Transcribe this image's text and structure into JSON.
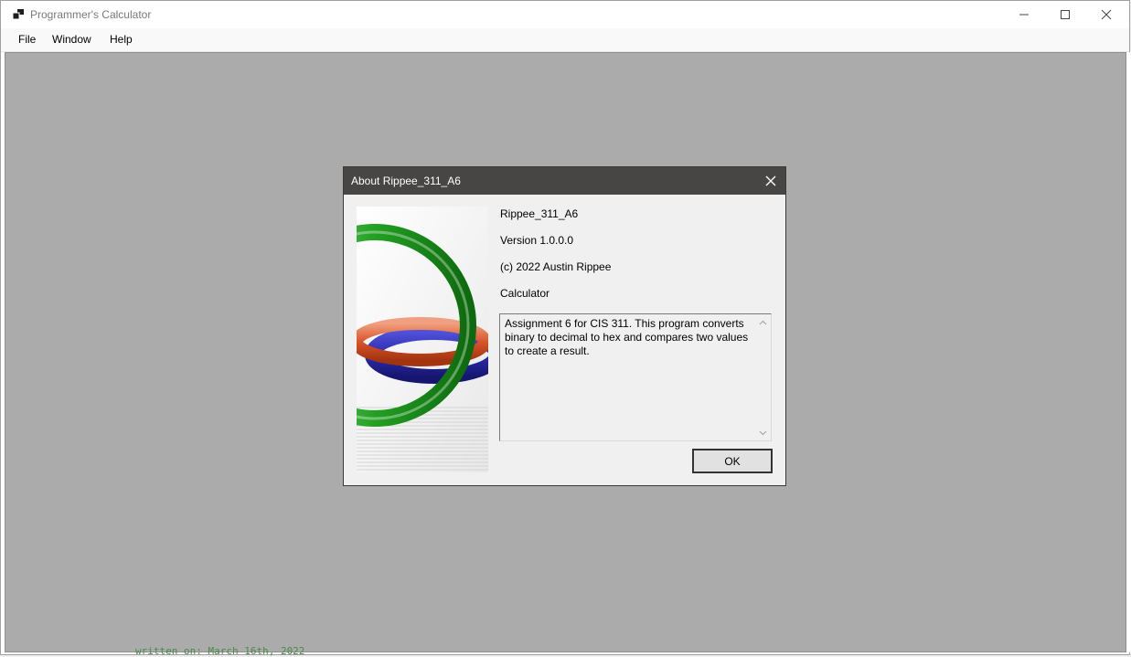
{
  "window": {
    "title": "Programmer's Calculator",
    "caption_icons": [
      "minimize-icon",
      "maximize-icon",
      "close-icon"
    ]
  },
  "menu": {
    "items": [
      {
        "label": "File"
      },
      {
        "label": "Window"
      },
      {
        "label": "Help"
      }
    ]
  },
  "dialog": {
    "title": "About Rippee_311_A6",
    "product_name": "Rippee_311_A6",
    "version": "Version 1.0.0.0",
    "copyright": "(c) 2022 Austin Rippee",
    "company": "Calculator",
    "description": "Assignment 6 for CIS 311. This program converts binary to decimal to hex and compares two values to create a result.",
    "ok_label": "OK"
  },
  "background": {
    "partial_text": "written on: March 16th, 2022"
  },
  "colors": {
    "mdi_background": "#ababab",
    "dialog_titlebar": "#474645",
    "ring_green": "#2a9a2a",
    "ring_orange": "#d9542a",
    "ring_blue": "#2c2cb0"
  }
}
